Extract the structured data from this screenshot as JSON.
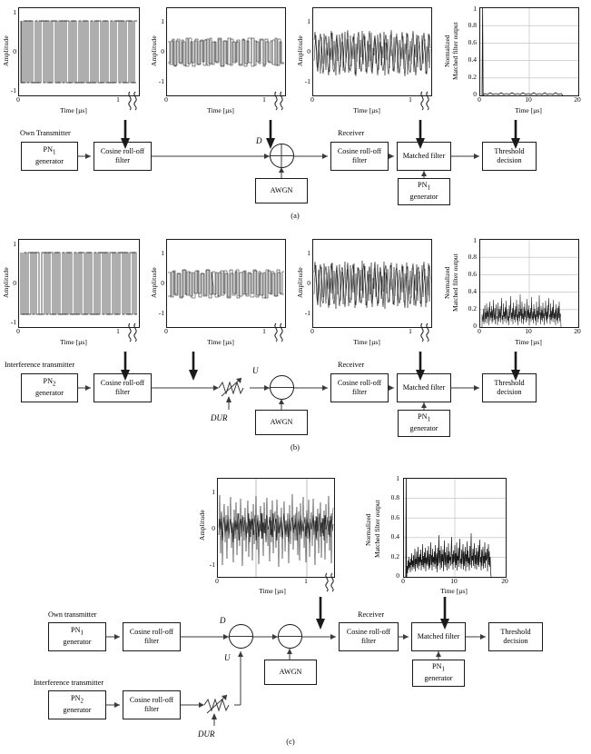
{
  "figure": {
    "captions": {
      "a": "(a)",
      "b": "(b)",
      "c": "(c)"
    }
  },
  "labels": {
    "own_transmitter_caps": "Own Transmitter",
    "own_transmitter": "Own transmitter",
    "interference_transmitter": "Interference transmitter",
    "receiver": "Receiver",
    "pn1_line1": "PN",
    "pn1_sub": "1",
    "pn2_sub": "2",
    "generator": "generator",
    "cosine_line1": "Cosine roll-off",
    "cosine_line2": "filter",
    "matched_filter": "Matched filter",
    "threshold_line1": "Threshold",
    "threshold_line2": "decision",
    "awgn": "AWGN",
    "signal_d": "D",
    "signal_u": "U",
    "dur": "DUR"
  },
  "axes": {
    "amplitude": "Amplitude",
    "time": "Time [µs]",
    "normalized": "Normalized",
    "mf_output": "Matched filter output",
    "amp_ticks": [
      "1",
      "0",
      "-1"
    ],
    "time_ticks_short": [
      "0",
      "1"
    ],
    "mf_ticks": [
      "1",
      "0.8",
      "0.6",
      "0.4",
      "0.2",
      "0"
    ],
    "time_ticks_long": [
      "0",
      "10",
      "20"
    ]
  },
  "chart_data": [
    {
      "id": "a1",
      "type": "line",
      "title": "",
      "xlabel": "Time [µs]",
      "ylabel": "Amplitude",
      "xlim": [
        0,
        1.15
      ],
      "ylim": [
        -1.25,
        1.25
      ],
      "xticks": [
        0,
        1
      ],
      "yticks": [
        -1,
        0,
        1
      ],
      "grid": false,
      "axis_break": true,
      "description": "PN1 baseband bipolar chip sequence, own transmitter",
      "waveform": "square-bipolar",
      "amplitude": 1.0,
      "chips": 64
    },
    {
      "id": "a2",
      "type": "line",
      "xlabel": "Time [µs]",
      "ylabel": "Amplitude",
      "xlim": [
        0,
        1.15
      ],
      "ylim": [
        -1.25,
        1.25
      ],
      "xticks": [
        0,
        1
      ],
      "yticks": [
        -1,
        0,
        1
      ],
      "grid": false,
      "axis_break": true,
      "description": "Cosine roll-off filtered PN1 signal D",
      "waveform": "filtered-bipolar",
      "amplitude": 0.55,
      "chips": 64
    },
    {
      "id": "a3",
      "type": "line",
      "xlabel": "Time [µs]",
      "ylabel": "Amplitude",
      "xlim": [
        0,
        1.15
      ],
      "ylim": [
        -1.25,
        1.25
      ],
      "xticks": [
        0,
        1
      ],
      "yticks": [
        -1,
        0,
        1
      ],
      "grid": false,
      "axis_break": true,
      "description": "Received signal D + AWGN after receive cosine roll-off filter",
      "waveform": "filtered-bipolar-noisy",
      "amplitude": 0.55,
      "noise": 0.3,
      "chips": 64
    },
    {
      "id": "a4",
      "type": "line",
      "xlabel": "Time [µs]",
      "ylabel": "Normalized Matched filter output",
      "xlim": [
        0,
        20
      ],
      "ylim": [
        0,
        1
      ],
      "xticks": [
        0,
        10,
        20
      ],
      "yticks": [
        0,
        0.2,
        0.4,
        0.6,
        0.8,
        1
      ],
      "grid": true,
      "description": "Matched filter output with correct PN1 despreading: single correlation peak of 1.0 near t=0, negligible sidelobes",
      "peak_time": 0.3,
      "peak_value": 1.0,
      "noise_floor": 0.02,
      "signal_end": 17
    },
    {
      "id": "b1",
      "type": "line",
      "xlabel": "Time [µs]",
      "ylabel": "Amplitude",
      "xlim": [
        0,
        1.15
      ],
      "ylim": [
        -1.25,
        1.25
      ],
      "xticks": [
        0,
        1
      ],
      "yticks": [
        -1,
        0,
        1
      ],
      "grid": false,
      "axis_break": true,
      "description": "PN2 baseband bipolar chip sequence, interference transmitter",
      "waveform": "square-bipolar",
      "amplitude": 1.0,
      "chips": 64
    },
    {
      "id": "b2",
      "type": "line",
      "xlabel": "Time [µs]",
      "ylabel": "Amplitude",
      "xlim": [
        0,
        1.15
      ],
      "ylim": [
        -1.25,
        1.25
      ],
      "xticks": [
        0,
        1
      ],
      "yticks": [
        -1,
        0,
        1
      ],
      "grid": false,
      "axis_break": true,
      "description": "Cosine roll-off filtered PN2 interference signal U",
      "waveform": "filtered-bipolar",
      "amplitude": 0.55,
      "chips": 64
    },
    {
      "id": "b3",
      "type": "line",
      "xlabel": "Time [µs]",
      "ylabel": "Amplitude",
      "xlim": [
        0,
        1.15
      ],
      "ylim": [
        -1.25,
        1.25
      ],
      "xticks": [
        0,
        1
      ],
      "yticks": [
        -1,
        0,
        1
      ],
      "grid": false,
      "axis_break": true,
      "description": "Interference signal U + AWGN after receive cosine roll-off filter",
      "waveform": "filtered-bipolar-noisy",
      "amplitude": 0.55,
      "noise": 0.32,
      "chips": 64
    },
    {
      "id": "b4",
      "type": "line",
      "xlabel": "Time [µs]",
      "ylabel": "Normalized Matched filter output",
      "xlim": [
        0,
        20
      ],
      "ylim": [
        0,
        1
      ],
      "xticks": [
        0,
        10,
        20
      ],
      "yticks": [
        0,
        0.2,
        0.4,
        0.6,
        0.8,
        1
      ],
      "grid": true,
      "description": "Matched filter output for interference only (PN2 vs PN1): no correlation peak, cross-correlation noise up to about 0.35",
      "peak_value": 0.35,
      "noise_floor": 0.12,
      "signal_end": 17
    },
    {
      "id": "c1",
      "type": "line",
      "xlabel": "Time [µs]",
      "ylabel": "Amplitude",
      "xlim": [
        0,
        1.15
      ],
      "ylim": [
        -1.25,
        1.25
      ],
      "xticks": [
        0,
        1
      ],
      "yticks": [
        -1,
        0,
        1
      ],
      "grid": false,
      "axis_break": true,
      "description": "Combined received signal D + U + AWGN after receive cosine roll-off filter",
      "waveform": "noise-dense",
      "amplitude": 0.45,
      "noise": 0.55,
      "chips": 64
    },
    {
      "id": "c2",
      "type": "line",
      "xlabel": "Time [µs]",
      "ylabel": "Normalized Matched filter output",
      "xlim": [
        0,
        20
      ],
      "ylim": [
        0,
        1
      ],
      "xticks": [
        0,
        10,
        20
      ],
      "yticks": [
        0,
        0.2,
        0.4,
        0.6,
        0.8,
        1
      ],
      "grid": true,
      "description": "Matched filter output for D + U + AWGN: correlation peak of 1.0 near t=0 above interference floor reaching about 0.35",
      "peak_time": 0.3,
      "peak_value": 1.0,
      "noise_floor": 0.15,
      "signal_end": 17
    }
  ]
}
